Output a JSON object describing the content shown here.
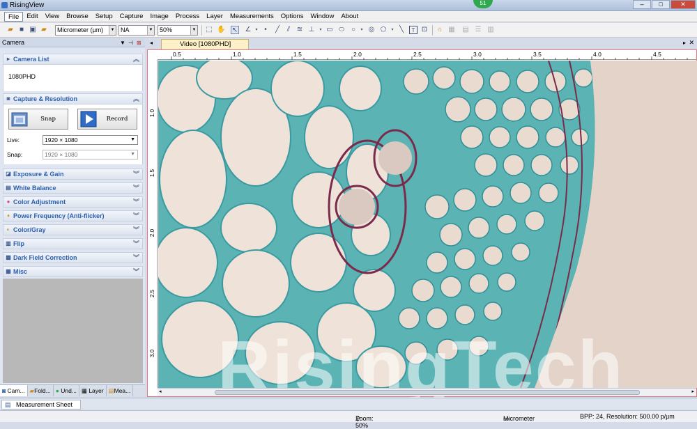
{
  "window": {
    "title": "RisingView",
    "badge": "51",
    "minimize": "–",
    "maximize": "□",
    "close": "✕"
  },
  "menu": [
    "File",
    "Edit",
    "View",
    "Browse",
    "Setup",
    "Capture",
    "Image",
    "Process",
    "Layer",
    "Measurements",
    "Options",
    "Window",
    "About"
  ],
  "toolbar": {
    "unit": "Micrometer (µm)",
    "magnification": "NA",
    "zoom": "50%"
  },
  "panel": {
    "title": "Camera",
    "camera_list": {
      "label": "Camera List",
      "item": "1080PHD"
    },
    "capture": {
      "label": "Capture & Resolution",
      "snap_label": "Snap",
      "record_label": "Record",
      "live_label": "Live:",
      "live_value": "1920 × 1080",
      "snap_res_label": "Snap:",
      "snap_res_value": "1920 × 1080"
    },
    "sections": [
      "Exposure & Gain",
      "White Balance",
      "Color Adjustment",
      "Power Frequency (Anti-flicker)",
      "Color/Gray",
      "Flip",
      "Dark Field Correction",
      "Misc"
    ],
    "tabs": [
      "Cam...",
      "Fold...",
      "Und...",
      "Layer",
      "Mea..."
    ]
  },
  "document": {
    "tab": "Video [1080PHD]",
    "watermark": "RisingTech"
  },
  "ruler": {
    "h": [
      "0.5",
      "1.0",
      "1.5",
      "2.0",
      "2.5",
      "3.0",
      "3.5",
      "4.0",
      "4.5"
    ],
    "v": [
      "1.0",
      "1.5",
      "2.0",
      "2.5",
      "3.0"
    ]
  },
  "sheet_tab": "Measurement Sheet",
  "status": {
    "zoom": "Zoom: 50%",
    "unit": "Micrometer",
    "bpp": "BPP: 24, Resolution: 500.00 p/µm"
  }
}
